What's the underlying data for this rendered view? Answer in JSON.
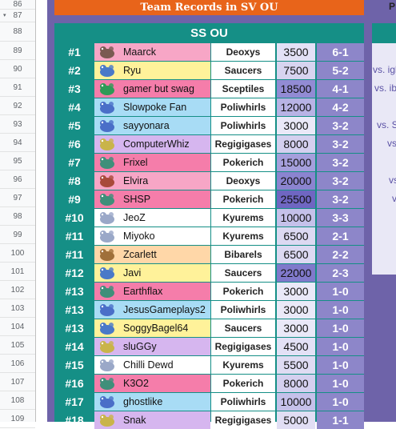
{
  "sheet": {
    "row_numbers": [
      "86",
      "87",
      "88",
      "89",
      "90",
      "91",
      "92",
      "93",
      "94",
      "95",
      "96",
      "97",
      "98",
      "99",
      "100",
      "101",
      "102",
      "103",
      "104",
      "105",
      "106",
      "107",
      "108",
      "109"
    ]
  },
  "header": {
    "title": "Team Records in SV OU",
    "right_partial": "P"
  },
  "table": {
    "heading": "SS OU",
    "rows": [
      {
        "rank": "#1",
        "name": "Maarck",
        "team": "Deoxys",
        "score": "3500",
        "record": "6-1",
        "row_color": "#f7a6c6",
        "score_color": "#e3e1f6",
        "sprite_color": "#7a5a52"
      },
      {
        "rank": "#2",
        "name": "Ryu",
        "team": "Saucers",
        "score": "7500",
        "record": "5-2",
        "row_color": "#fff29a",
        "score_color": "#d7d4f0",
        "sprite_color": "#4a79c8"
      },
      {
        "rank": "#3",
        "name": "gamer but swag",
        "team": "Sceptiles",
        "score": "18500",
        "record": "4-1",
        "row_color": "#f57daa",
        "score_color": "#928bd4",
        "sprite_color": "#2f9a57"
      },
      {
        "rank": "#4",
        "name": "Slowpoke Fan",
        "team": "Poliwhirls",
        "score": "12000",
        "record": "4-2",
        "row_color": "#a8dcf5",
        "score_color": "#b8b3e5",
        "sprite_color": "#4a6fc8"
      },
      {
        "rank": "#5",
        "name": "sayyonara",
        "team": "Poliwhirls",
        "score": "3000",
        "record": "3-2",
        "row_color": "#a8dcf5",
        "score_color": "#eae9f8",
        "sprite_color": "#4a6fc8"
      },
      {
        "rank": "#6",
        "name": "ComputerWhiz",
        "team": "Regigigases",
        "score": "8000",
        "record": "3-2",
        "row_color": "#d6b6ef",
        "score_color": "#d4d0ef",
        "sprite_color": "#c9b44a"
      },
      {
        "rank": "#7",
        "name": "Frixel",
        "team": "Pokerich",
        "score": "15000",
        "record": "3-2",
        "row_color": "#f57daa",
        "score_color": "#a59fdc",
        "sprite_color": "#3f8f7a"
      },
      {
        "rank": "#8",
        "name": "Elvira",
        "team": "Deoxys",
        "score": "20000",
        "record": "3-2",
        "row_color": "#f7a6c6",
        "score_color": "#8b84d0",
        "sprite_color": "#a84a3a"
      },
      {
        "rank": "#9",
        "name": "SHSP",
        "team": "Pokerich",
        "score": "25500",
        "record": "3-2",
        "row_color": "#f57daa",
        "score_color": "#6f66c2",
        "sprite_color": "#3f8f7a"
      },
      {
        "rank": "#10",
        "name": "JeoZ",
        "team": "Kyurems",
        "score": "10000",
        "record": "3-3",
        "row_color": "#ffffff",
        "score_color": "#c5c1ea",
        "sprite_color": "#9aa8c8"
      },
      {
        "rank": "#11",
        "name": "Miyoko",
        "team": "Kyurems",
        "score": "6500",
        "record": "2-1",
        "row_color": "#ffffff",
        "score_color": "#dcd9f2",
        "sprite_color": "#9aa8c8"
      },
      {
        "rank": "#11",
        "name": "Zcarlett",
        "team": "Bibarels",
        "score": "6500",
        "record": "2-2",
        "row_color": "#ffd7a8",
        "score_color": "#dcd9f2",
        "sprite_color": "#a0703a"
      },
      {
        "rank": "#12",
        "name": "Javi",
        "team": "Saucers",
        "score": "22000",
        "record": "2-3",
        "row_color": "#fff29a",
        "score_color": "#8079cb",
        "sprite_color": "#4a79c8"
      },
      {
        "rank": "#13",
        "name": "Earthflax",
        "team": "Pokerich",
        "score": "3000",
        "record": "1-0",
        "row_color": "#f57daa",
        "score_color": "#eae9f8",
        "sprite_color": "#3f8f7a"
      },
      {
        "rank": "#13",
        "name": "JesusGameplays2",
        "team": "Poliwhirls",
        "score": "3000",
        "record": "1-0",
        "row_color": "#a8dcf5",
        "score_color": "#eae9f8",
        "sprite_color": "#4a6fc8"
      },
      {
        "rank": "#13",
        "name": "SoggyBagel64",
        "team": "Saucers",
        "score": "3000",
        "record": "1-0",
        "row_color": "#fff29a",
        "score_color": "#eae9f8",
        "sprite_color": "#4a79c8"
      },
      {
        "rank": "#14",
        "name": "sluGGy",
        "team": "Regigigases",
        "score": "4500",
        "record": "1-0",
        "row_color": "#d6b6ef",
        "score_color": "#e3e1f6",
        "sprite_color": "#c9b44a"
      },
      {
        "rank": "#15",
        "name": "Chilli Dewd",
        "team": "Kyurems",
        "score": "5500",
        "record": "1-0",
        "row_color": "#ffffff",
        "score_color": "#dfdcf3",
        "sprite_color": "#9aa8c8"
      },
      {
        "rank": "#16",
        "name": "K3O2",
        "team": "Pokerich",
        "score": "8000",
        "record": "1-0",
        "row_color": "#f57daa",
        "score_color": "#d4d0ef",
        "sprite_color": "#3f8f7a"
      },
      {
        "rank": "#17",
        "name": "ghostlike",
        "team": "Poliwhirls",
        "score": "10000",
        "record": "1-0",
        "row_color": "#a8dcf5",
        "score_color": "#c5c1ea",
        "sprite_color": "#4a6fc8"
      },
      {
        "rank": "#18",
        "name": "Snak",
        "team": "Regigigases",
        "score": "5000",
        "record": "1-1",
        "row_color": "#d6b6ef",
        "score_color": "#e1def4",
        "sprite_color": "#c9b44a"
      }
    ]
  },
  "right_panel": {
    "texts": [
      "vs. igl",
      "vs. ib",
      "vs. S",
      "vs",
      "vs",
      "v"
    ]
  },
  "colors": {
    "header_orange": "#e8641a",
    "teal": "#158f86",
    "purple_bg": "#6e63a9",
    "record_cell": "#8d86c9"
  }
}
